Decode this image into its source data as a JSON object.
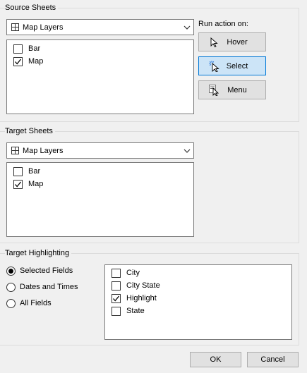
{
  "source": {
    "title": "Source Sheets",
    "dropdown_value": "Map Layers",
    "items": [
      {
        "label": "Bar",
        "checked": false
      },
      {
        "label": "Map",
        "checked": true
      }
    ]
  },
  "run_action": {
    "label": "Run action on:",
    "buttons": [
      {
        "label": "Hover",
        "icon": "hover-cursor-icon",
        "selected": false
      },
      {
        "label": "Select",
        "icon": "select-cursor-icon",
        "selected": true
      },
      {
        "label": "Menu",
        "icon": "menu-cursor-icon",
        "selected": false
      }
    ]
  },
  "target": {
    "title": "Target Sheets",
    "dropdown_value": "Map Layers",
    "items": [
      {
        "label": "Bar",
        "checked": false
      },
      {
        "label": "Map",
        "checked": true
      }
    ]
  },
  "highlighting": {
    "title": "Target Highlighting",
    "options": [
      {
        "label": "Selected Fields",
        "selected": true
      },
      {
        "label": "Dates and Times",
        "selected": false
      },
      {
        "label": "All Fields",
        "selected": false
      }
    ],
    "fields": [
      {
        "label": "City",
        "checked": false
      },
      {
        "label": "City State",
        "checked": false
      },
      {
        "label": "Highlight",
        "checked": true
      },
      {
        "label": "State",
        "checked": false
      }
    ]
  },
  "footer": {
    "ok_label": "OK",
    "cancel_label": "Cancel"
  },
  "colors": {
    "selected_button_bg": "#cce4f7",
    "selected_button_border": "#0078d7"
  }
}
